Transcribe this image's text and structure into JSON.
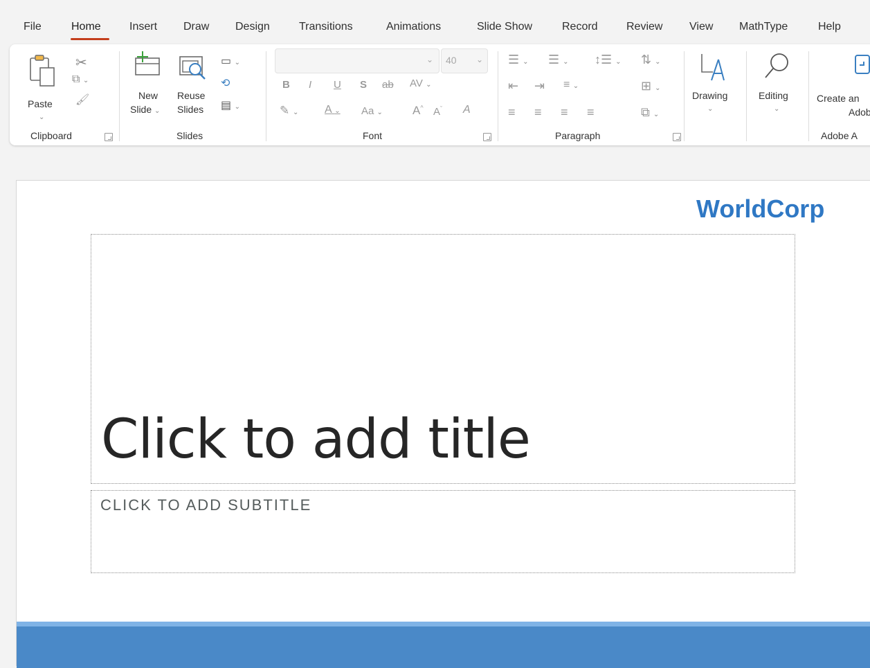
{
  "tabs": [
    "File",
    "Home",
    "Insert",
    "Draw",
    "Design",
    "Transitions",
    "Animations",
    "Slide Show",
    "Record",
    "Review",
    "View",
    "MathType",
    "Help"
  ],
  "active_tab": "Home",
  "ribbon": {
    "clipboard": {
      "paste_label": "Paste",
      "group_label": "Clipboard"
    },
    "slides": {
      "new_slide_line1": "New",
      "new_slide_line2": "Slide",
      "reuse_line1": "Reuse",
      "reuse_line2": "Slides",
      "group_label": "Slides"
    },
    "font": {
      "font_name": "",
      "font_size": "40",
      "bold": "B",
      "italic": "I",
      "underline": "U",
      "shadow": "S",
      "strikethrough": "ab",
      "spacing": "AV",
      "highlight": "A",
      "font_color": "A",
      "change_case": "Aa",
      "grow": "A",
      "shrink": "A",
      "clear": "A",
      "group_label": "Font"
    },
    "paragraph": {
      "group_label": "Paragraph"
    },
    "drawing_label": "Drawing",
    "editing_label": "Editing",
    "adobe": {
      "line1": "Create an",
      "line2": "Adobe",
      "group_label": "Adobe A"
    }
  },
  "slide": {
    "logo_text": "WorldCorp",
    "title_placeholder": "Click to add title",
    "subtitle_placeholder": "CLICK TO ADD SUBTITLE"
  },
  "colors": {
    "accent_tab": "#c43e1c",
    "logo": "#2f78c4",
    "footer_bar": "#4a89c8",
    "footer_bar_light": "#7fb3e6"
  }
}
